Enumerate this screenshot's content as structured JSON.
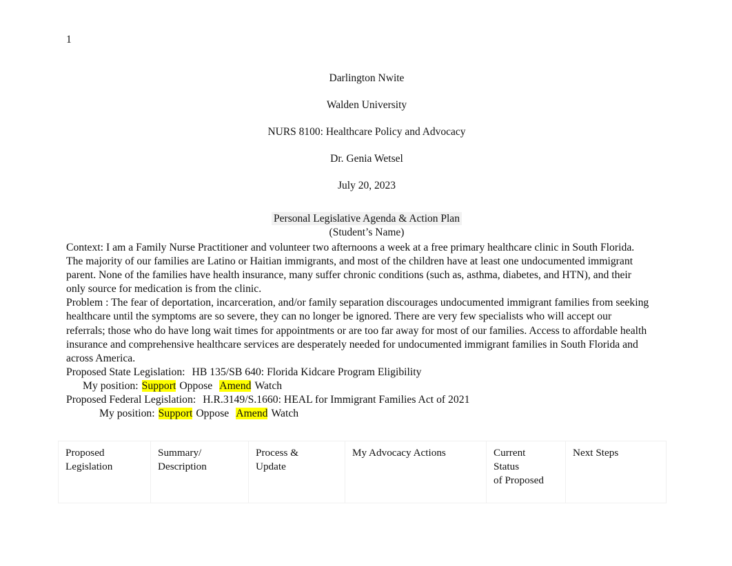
{
  "document": {
    "page_number": "1",
    "title_block": [
      "Darlington Nwite",
      "Walden University",
      "NURS 8100: Healthcare Policy and Advocacy",
      "Dr. Genia Wetsel",
      "July 20, 2023"
    ],
    "assignment_title": "Personal Legislative Agenda & Action Plan",
    "assignment_subtitle": "(Student’s Name)",
    "sections": {
      "context": "Context:  I am a Family Nurse Practitioner and volunteer two afternoons a week at a free primary healthcare clinic in South Florida. The majority of our families are Latino or Haitian immigrants, and most of the children have at least one undocumented immigrant parent. None of the families have health insurance, many suffer chronic conditions (such as, asthma, diabetes, and HTN), and their only source for medication is from the clinic.",
      "problem": "Problem : The fear of deportation, incarceration, and/or family separation discourages undocumented immigrant families from seeking healthcare until the symptoms are so severe, they can no longer be ignored. There are very few specialists who will accept our referrals; those who do have long wait times for appointments or are too far away for most of our families. Access to affordable health insurance and comprehensive healthcare services are desperately needed for undocumented immigrant families in South Florida and across America."
    },
    "legislation": {
      "state": {
        "label": "Proposed State Legislation:",
        "bill": "HB 135/SB 640: Florida Kidcare Program Eligibility",
        "position_label": "My position:",
        "options": [
          {
            "text": "Support",
            "highlighted": true
          },
          {
            "text": "Oppose",
            "highlighted": false
          },
          {
            "text": "Amend",
            "highlighted": true
          },
          {
            "text": "Watch",
            "highlighted": false
          }
        ]
      },
      "federal": {
        "label": "Proposed Federal Legislation:",
        "bill": "H.R.3149/S.1660: HEAL for Immigrant Families Act of 2021",
        "position_label": "My position:",
        "options": [
          {
            "text": "Support",
            "highlighted": true
          },
          {
            "text": "Oppose",
            "highlighted": false
          },
          {
            "text": "Amend",
            "highlighted": true
          },
          {
            "text": "Watch",
            "highlighted": false
          }
        ]
      }
    },
    "table": {
      "headers": [
        "Proposed\nLegislation",
        "Summary/\nDescription",
        "Process &\nUpdate",
        "My Advocacy Actions",
        "Current\nStatus\nof Proposed",
        "Next Steps"
      ],
      "header_lines": [
        [
          "Proposed",
          "Legislation"
        ],
        [
          "Summary/",
          "Description"
        ],
        [
          "Process &",
          "Update"
        ],
        [
          "My Advocacy Actions"
        ],
        [
          "Current",
          "Status",
          "of Proposed"
        ],
        [
          "Next Steps"
        ]
      ]
    }
  },
  "colors": {
    "highlight": "#ffff00",
    "title_shade": "#f1f1f1",
    "table_border": "#f0f0f0",
    "text": "#111111",
    "background": "#ffffff"
  }
}
